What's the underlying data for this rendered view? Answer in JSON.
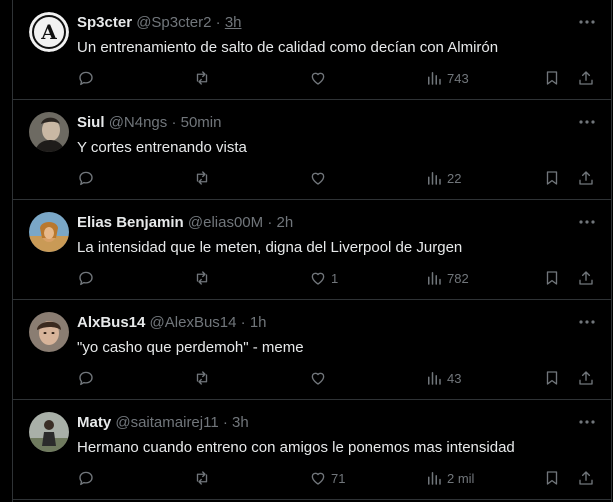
{
  "tweets": [
    {
      "display_name": "Sp3cter",
      "handle": "@Sp3cter2",
      "dot": "·",
      "time": "3h",
      "text": "Un entrenamiento de salto de calidad como decían con Almirón",
      "likes": "",
      "views": "743"
    },
    {
      "display_name": "Siul",
      "handle": "@N4ngs",
      "dot": "·",
      "time": "50min",
      "text": "Y cortes entrenando vista",
      "likes": "",
      "views": "22"
    },
    {
      "display_name": "Elias Benjamin",
      "handle": "@elias00M",
      "dot": "·",
      "time": "2h",
      "text": "La intensidad que le meten, digna del Liverpool de Jurgen",
      "likes": "1",
      "views": "782"
    },
    {
      "display_name": "AlxBus14",
      "handle": "@AlexBus14",
      "dot": "·",
      "time": "1h",
      "text": "\"yo casho que perdemoh\" - meme",
      "likes": "",
      "views": "43"
    },
    {
      "display_name": "Maty",
      "handle": "@saitamairej11",
      "dot": "·",
      "time": "3h",
      "text": "Hermano cuando entreno con amigos le ponemos mas intensidad",
      "likes": "71",
      "views": "2 mil"
    }
  ],
  "icons": {
    "more": "more-icon",
    "reply": "reply-icon",
    "retweet": "retweet-icon",
    "like": "like-icon",
    "views": "views-icon",
    "bookmark": "bookmark-icon",
    "share": "share-icon"
  },
  "colors": {
    "background": "#000000",
    "text": "#e7e9ea",
    "secondary": "#71767b",
    "border": "#2f3336"
  }
}
